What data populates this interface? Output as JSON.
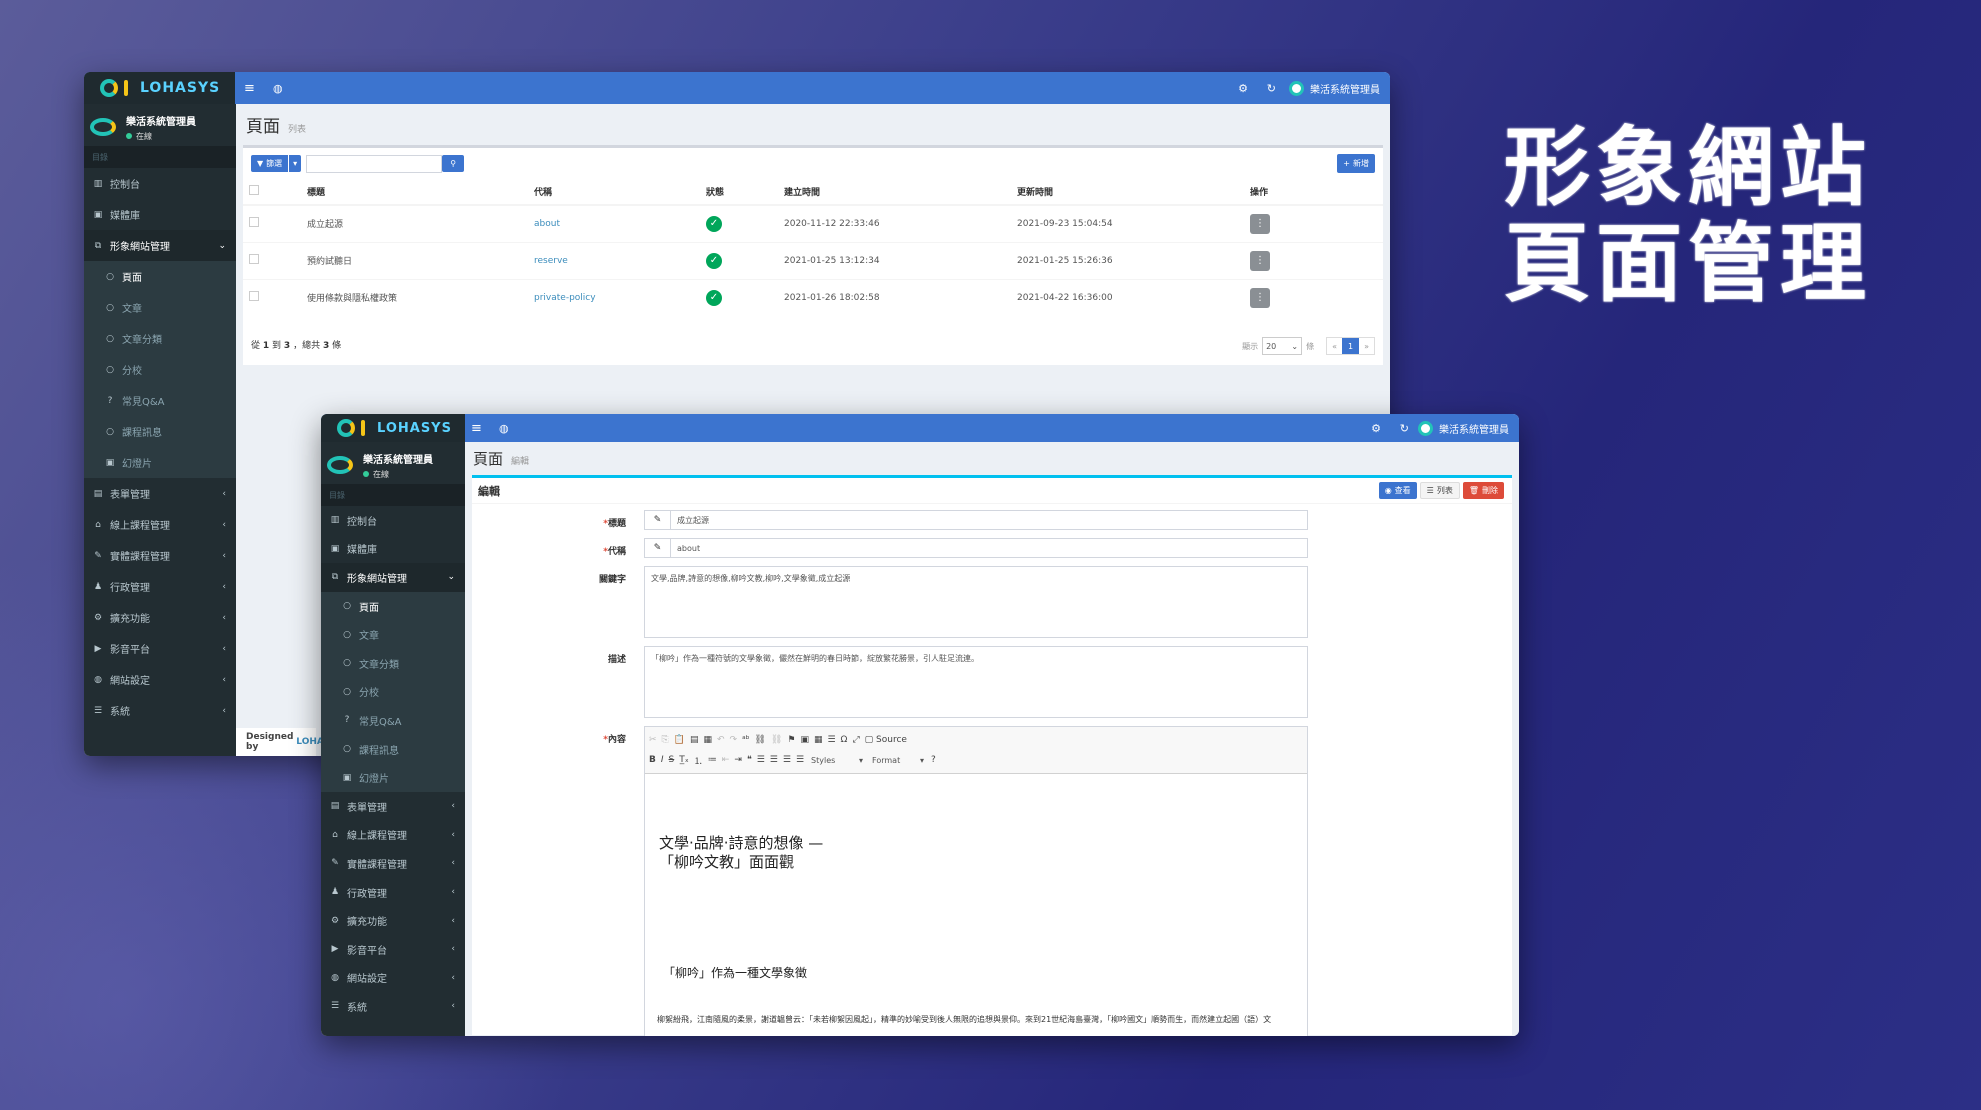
{
  "hero": {
    "line1": "形象網站",
    "line2": "頁面管理"
  },
  "brand": "LOHASYS",
  "user": {
    "name": "樂活系統管理員",
    "status": "在線"
  },
  "sidebar": {
    "section": "目錄",
    "items": [
      {
        "label": "控制台",
        "icon": "chart-icon"
      },
      {
        "label": "媒體庫",
        "icon": "image-icon"
      },
      {
        "label": "形象網站管理",
        "icon": "sitemap-icon",
        "open": true
      },
      {
        "label": "表單管理",
        "icon": "form-icon"
      },
      {
        "label": "線上課程管理",
        "icon": "bank-icon"
      },
      {
        "label": "實體課程管理",
        "icon": "edit-icon"
      },
      {
        "label": "行政管理",
        "icon": "user-icon"
      },
      {
        "label": "擴充功能",
        "icon": "cogs-icon"
      },
      {
        "label": "影音平台",
        "icon": "video-icon"
      },
      {
        "label": "網站設定",
        "icon": "globe-icon"
      },
      {
        "label": "系統",
        "icon": "list-icon"
      }
    ],
    "submenu": [
      {
        "label": "頁面",
        "icon": "circle-icon"
      },
      {
        "label": "文章",
        "icon": "circle-icon"
      },
      {
        "label": "文章分類",
        "icon": "circle-icon"
      },
      {
        "label": "分校",
        "icon": "circle-icon"
      },
      {
        "label": "常見Q&A",
        "icon": "question-icon"
      },
      {
        "label": "課程訊息",
        "icon": "circle-icon"
      },
      {
        "label": "幻燈片",
        "icon": "image-icon"
      }
    ]
  },
  "list": {
    "title": "頁面",
    "subtitle": "列表",
    "filter_label": "篩選",
    "add_label": "新增",
    "columns": [
      "標題",
      "代稱",
      "狀態",
      "建立時間",
      "更新時間",
      "操作"
    ],
    "rows": [
      {
        "title": "成立起源",
        "slug": "about",
        "created": "2020-11-12 22:33:46",
        "updated": "2021-09-23 15:04:54"
      },
      {
        "title": "預約試聽日",
        "slug": "reserve",
        "created": "2021-01-25 13:12:34",
        "updated": "2021-01-25 15:26:36"
      },
      {
        "title": "使用條款與隱私權政策",
        "slug": "private-policy",
        "created": "2021-01-26 18:02:58",
        "updated": "2021-04-22 16:36:00"
      }
    ],
    "summary_pre": "從",
    "summary_from": "1",
    "summary_mid1": "到",
    "summary_to": "3",
    "summary_mid2": "，總共",
    "summary_total": "3",
    "summary_post": "條",
    "show_label": "顯示",
    "per_page": "20",
    "per_page_suffix": "條",
    "page": "1",
    "prev": "«",
    "next": "»",
    "footer_designed": "Designed by",
    "footer_brand": "LOHAS"
  },
  "edit": {
    "title": "頁面",
    "subtitle": "編輯",
    "box_title": "編輯",
    "btn_view": "查看",
    "btn_list": "列表",
    "btn_delete": "刪除",
    "fields": {
      "title_label": "標題",
      "title_value": "成立起源",
      "slug_label": "代稱",
      "slug_value": "about",
      "keywords_label": "關鍵字",
      "keywords_value": "文學,品牌,詩意的想像,柳吟文教,柳吟,文學象徵,成立起源",
      "desc_label": "描述",
      "desc_value": "「柳吟」作為一種符號的文學象徵，儼然在鮮明的春日時節，綻放繁花勝景，引人駐足流連。",
      "content_label": "內容"
    },
    "editor": {
      "source_label": "Source",
      "styles_label": "Styles",
      "format_label": "Format",
      "heading_line1": "文學·品牌·詩意的想像 —",
      "heading_line2": "「柳吟文教」面面觀",
      "subheading": "「柳吟」作為一種文學象徵",
      "paragraph": "柳絮紛飛，江南隨風的柔景，謝道韞曾云：「未若柳絮因風起」，精準的妙喻受到後人無限的追想與景仰。來到21世紀海島臺灣，「柳吟國文」順勢而生，而然建立起國（語）文"
    }
  }
}
